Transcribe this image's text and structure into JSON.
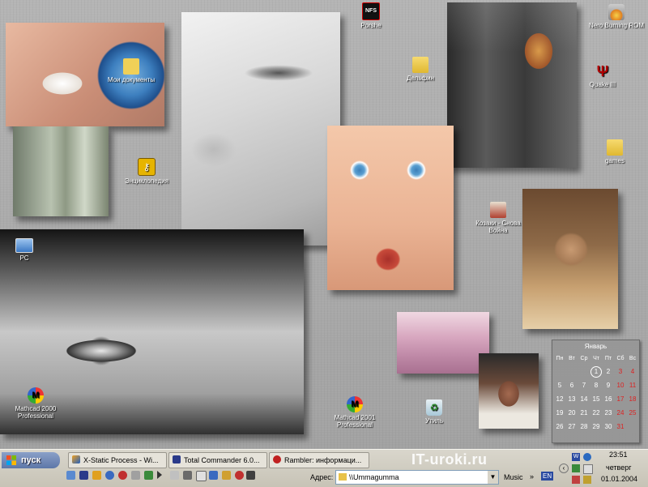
{
  "desktop_icons": [
    {
      "id": "porshe",
      "label": "Porshe",
      "icon": "nfs-game-icon"
    },
    {
      "id": "nero",
      "label": "Nero Burning ROM",
      "icon": "nero-icon"
    },
    {
      "id": "moi-dokumenty",
      "label": "Мои документы",
      "icon": "documents-globe-icon"
    },
    {
      "id": "delfin",
      "label": "Дельфин",
      "icon": "folder-icon"
    },
    {
      "id": "quake",
      "label": "Quake III",
      "icon": "quake-icon"
    },
    {
      "id": "games",
      "label": "games",
      "icon": "folder-icon"
    },
    {
      "id": "enciklopedia",
      "label": "Энциклопедия",
      "icon": "key-icon"
    },
    {
      "id": "kozaki",
      "label": "Козаки - Снова Война",
      "icon": "cossacks-icon"
    },
    {
      "id": "pc",
      "label": "PC",
      "icon": "computer-icon"
    },
    {
      "id": "mathcad2000",
      "label": "Mathcad 2000 Professional",
      "icon": "mathcad-icon"
    },
    {
      "id": "mathcad2001",
      "label": "Mathcad 2001 Professional",
      "icon": "mathcad-icon"
    },
    {
      "id": "utilit",
      "label": "Утиль",
      "icon": "recycle-bin-icon"
    }
  ],
  "taskbar": {
    "start_label": "пуск",
    "tasks": [
      {
        "label": "X-Static Process - Wi...",
        "icon": "xstatic-icon"
      },
      {
        "label": "Total Commander 6.0...",
        "icon": "floppy-icon"
      },
      {
        "label": "Rambler: информаци...",
        "icon": "rambler-icon"
      }
    ],
    "address_label": "Адрес:",
    "address_value": "\\\\Ummagumma",
    "music_label": "Music",
    "lang": "EN",
    "watermark": "IT-uroki.ru"
  },
  "clock": {
    "time": "23:51",
    "day": "четверг",
    "date": "01.01.2004"
  },
  "calendar": {
    "month": "Январь",
    "weekdays": [
      "Пн",
      "Вт",
      "Ср",
      "Чт",
      "Пт",
      "Сб",
      "Вс"
    ],
    "weeks": [
      [
        "",
        "",
        "",
        "1",
        "2",
        "3",
        "4"
      ],
      [
        "5",
        "6",
        "7",
        "8",
        "9",
        "10",
        "11"
      ],
      [
        "12",
        "13",
        "14",
        "15",
        "16",
        "17",
        "18"
      ],
      [
        "19",
        "20",
        "21",
        "22",
        "23",
        "24",
        "25"
      ],
      [
        "26",
        "27",
        "28",
        "29",
        "30",
        "31",
        ""
      ]
    ],
    "today": "1"
  },
  "colors": {
    "weekend": "#d22222",
    "start_button": "#6b84b4"
  }
}
